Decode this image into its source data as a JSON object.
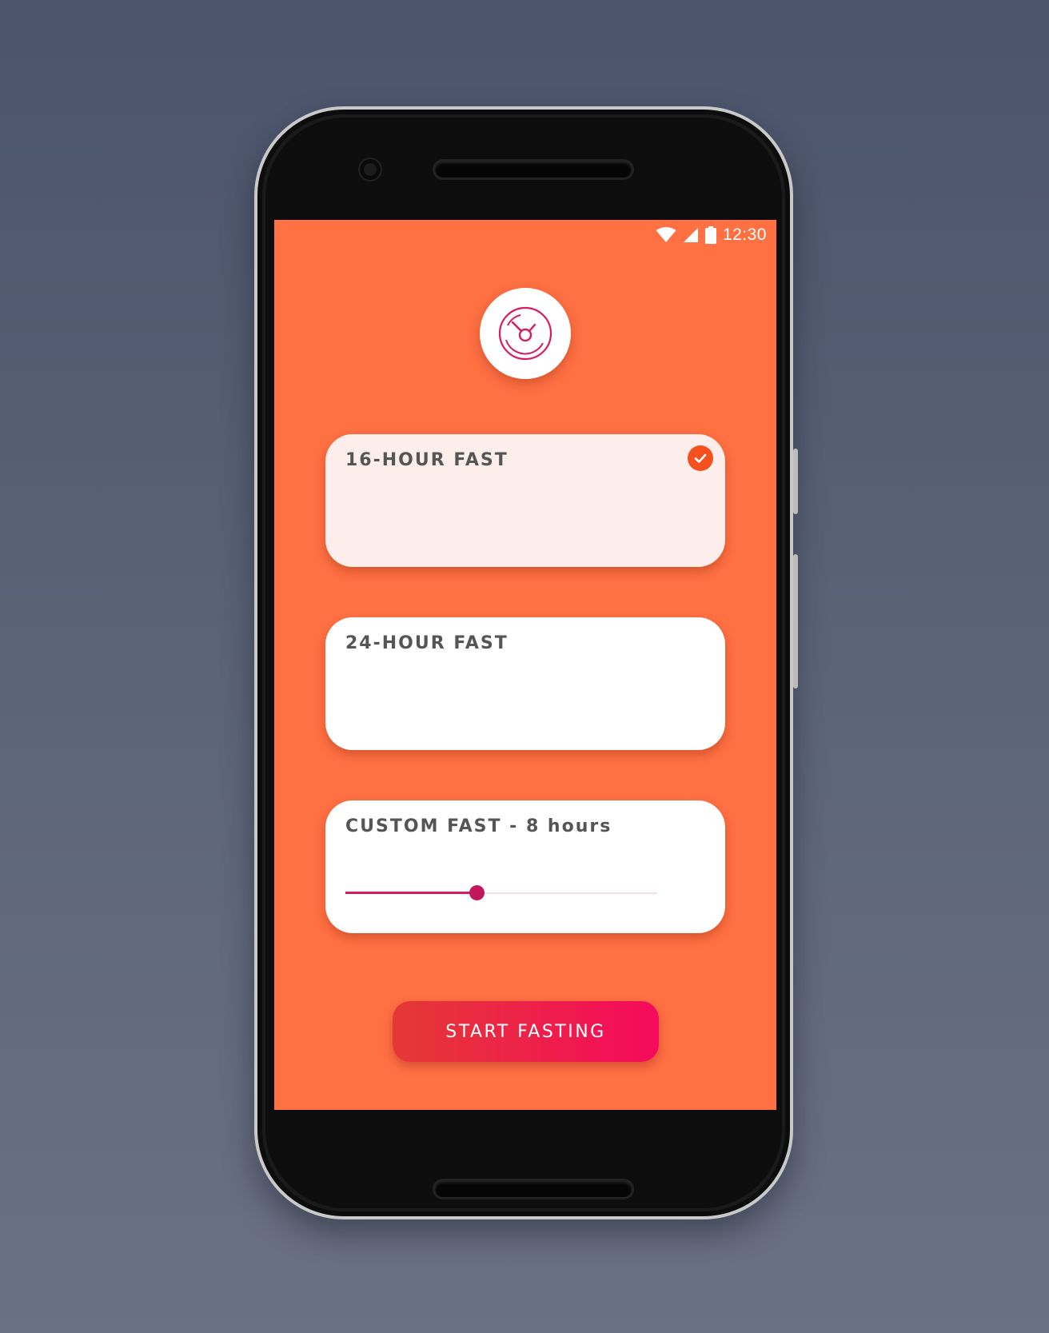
{
  "status_bar": {
    "time": "12:30",
    "icons": [
      "wifi-icon",
      "cellular-signal-icon",
      "battery-icon"
    ]
  },
  "app": {
    "logo_icon": "stopwatch-icon",
    "accent_color": "#ff7043",
    "primary_color": "#e91e63"
  },
  "options": [
    {
      "title": "16-HOUR FAST",
      "selected": true
    },
    {
      "title": "24-HOUR FAST",
      "selected": false
    },
    {
      "title": "CUSTOM FAST - 8 hours",
      "selected": false
    }
  ],
  "custom_slider": {
    "value_fraction": 0.42
  },
  "action": {
    "start_label": "START FASTING"
  }
}
